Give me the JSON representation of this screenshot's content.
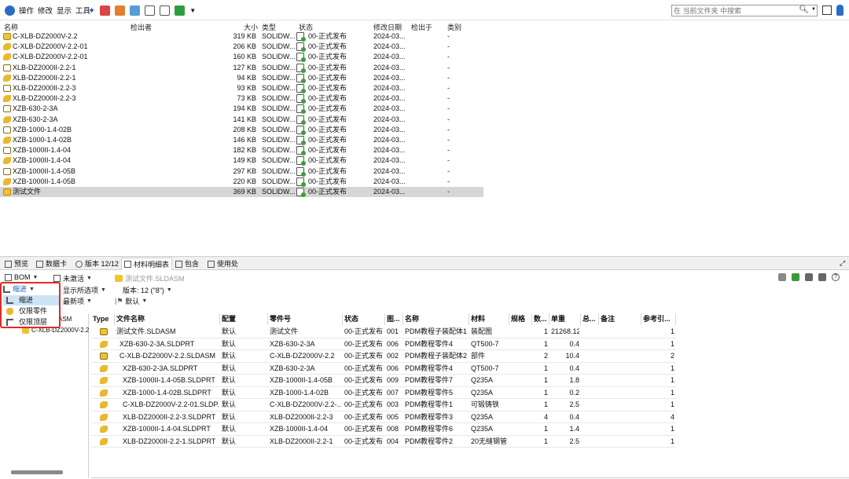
{
  "toolbar": {
    "actions": [
      "操作",
      "修改",
      "显示",
      "工具"
    ],
    "search_placeholder": "在 当前文件夹 中搜索"
  },
  "filelist": {
    "columns": {
      "name": "名称",
      "checked_out_by": "检出者",
      "size": "大小",
      "type": "类型",
      "state": "状态",
      "modified": "修改日期",
      "checked_out_in": "检出于",
      "category": "类别"
    },
    "rows": [
      {
        "name": "C-XLB-DZ2000V-2.2",
        "size": "319 KB",
        "type": "SOLIDW...",
        "state": "00-正式发布",
        "date": "2024-03...",
        "cat": "-",
        "kind": "asm"
      },
      {
        "name": "C-XLB-DZ2000V-2.2-01",
        "size": "206 KB",
        "type": "SOLIDW...",
        "state": "00-正式发布",
        "date": "2024-03...",
        "cat": "-",
        "kind": "prt"
      },
      {
        "name": "C-XLB-DZ2000V-2.2-01",
        "size": "160 KB",
        "type": "SOLIDW...",
        "state": "00-正式发布",
        "date": "2024-03...",
        "cat": "-",
        "kind": "prt"
      },
      {
        "name": "XLB-DZ2000II-2.2-1",
        "size": "127 KB",
        "type": "SOLIDW...",
        "state": "00-正式发布",
        "date": "2024-03...",
        "cat": "-",
        "kind": "drw"
      },
      {
        "name": "XLB-DZ2000II-2.2-1",
        "size": "94 KB",
        "type": "SOLIDW...",
        "state": "00-正式发布",
        "date": "2024-03...",
        "cat": "-",
        "kind": "prt"
      },
      {
        "name": "XLB-DZ2000II-2.2-3",
        "size": "93 KB",
        "type": "SOLIDW...",
        "state": "00-正式发布",
        "date": "2024-03...",
        "cat": "-",
        "kind": "drw"
      },
      {
        "name": "XLB-DZ2000II-2.2-3",
        "size": "73 KB",
        "type": "SOLIDW...",
        "state": "00-正式发布",
        "date": "2024-03...",
        "cat": "-",
        "kind": "prt"
      },
      {
        "name": "XZB-630-2-3A",
        "size": "194 KB",
        "type": "SOLIDW...",
        "state": "00-正式发布",
        "date": "2024-03...",
        "cat": "-",
        "kind": "drw"
      },
      {
        "name": "XZB-630-2-3A",
        "size": "141 KB",
        "type": "SOLIDW...",
        "state": "00-正式发布",
        "date": "2024-03...",
        "cat": "-",
        "kind": "prt"
      },
      {
        "name": "XZB-1000-1.4-02B",
        "size": "208 KB",
        "type": "SOLIDW...",
        "state": "00-正式发布",
        "date": "2024-03...",
        "cat": "-",
        "kind": "drw"
      },
      {
        "name": "XZB-1000-1.4-02B",
        "size": "146 KB",
        "type": "SOLIDW...",
        "state": "00-正式发布",
        "date": "2024-03...",
        "cat": "-",
        "kind": "prt"
      },
      {
        "name": "XZB-1000II-1.4-04",
        "size": "182 KB",
        "type": "SOLIDW...",
        "state": "00-正式发布",
        "date": "2024-03...",
        "cat": "-",
        "kind": "drw"
      },
      {
        "name": "XZB-1000II-1.4-04",
        "size": "149 KB",
        "type": "SOLIDW...",
        "state": "00-正式发布",
        "date": "2024-03...",
        "cat": "-",
        "kind": "prt"
      },
      {
        "name": "XZB-1000II-1.4-05B",
        "size": "297 KB",
        "type": "SOLIDW...",
        "state": "00-正式发布",
        "date": "2024-03...",
        "cat": "-",
        "kind": "drw"
      },
      {
        "name": "XZB-1000II-1.4-05B",
        "size": "220 KB",
        "type": "SOLIDW...",
        "state": "00-正式发布",
        "date": "2024-03...",
        "cat": "-",
        "kind": "prt"
      },
      {
        "name": "测试文件",
        "size": "369 KB",
        "type": "SOLIDW...",
        "state": "00-正式发布",
        "date": "2024-03...",
        "cat": "-",
        "kind": "asm"
      }
    ]
  },
  "bottom_tabs": {
    "preview": "预览",
    "datacard": "数据卡",
    "version": "版本 12/12",
    "bom": "材料明细表",
    "contains": "包含",
    "where_used": "使用处"
  },
  "bom_toolbar": {
    "bom": "BOM",
    "inactive": "未激活",
    "filename": "测试文件.SLDASM",
    "show_selected": "显示所选项",
    "version": "版本: 12 (\"8\")",
    "latest": "最新项",
    "default": "默认"
  },
  "dropdown": {
    "current": "缩进",
    "items": [
      "缩进",
      "仅限零件",
      "仅限顶层"
    ]
  },
  "tree": {
    "item1": "ASM",
    "item2": "C-XLB-DZ2000V-2.2"
  },
  "bom_table": {
    "columns": [
      "Type",
      "文件名称",
      "配置",
      "零件号",
      "状态",
      "图...",
      "名称",
      "材料",
      "规格",
      "数...",
      "单重",
      "总...",
      "备注",
      "参考引..."
    ],
    "rows": [
      {
        "file": "测试文件.SLDASM",
        "cfg": "默认",
        "pn": "测试文件",
        "state": "00-正式发布",
        "fig": "001",
        "name": "PDM教程子装配体1",
        "mat": "装配图",
        "qty": "1",
        "wt": "21268.12",
        "ref": "1",
        "kind": "asm",
        "indent": 0
      },
      {
        "file": "XZB-630-2-3A.SLDPRT",
        "cfg": "默认",
        "pn": "XZB-630-2-3A",
        "state": "00-正式发布",
        "fig": "006",
        "name": "PDM教程零件4",
        "mat": "QT500-7",
        "qty": "1",
        "wt": "0.4",
        "ref": "1",
        "kind": "prt",
        "indent": 1
      },
      {
        "file": "C-XLB-DZ2000V-2.2.SLDASM",
        "cfg": "默认",
        "pn": "C-XLB-DZ2000V-2.2",
        "state": "00-正式发布",
        "fig": "002",
        "name": "PDM教程子装配体2",
        "mat": "部件",
        "qty": "2",
        "wt": "10.4",
        "ref": "2",
        "kind": "asm",
        "indent": 1
      },
      {
        "file": "XZB-630-2-3A.SLDPRT",
        "cfg": "默认",
        "pn": "XZB-630-2-3A",
        "state": "00-正式发布",
        "fig": "006",
        "name": "PDM教程零件4",
        "mat": "QT500-7",
        "qty": "1",
        "wt": "0.4",
        "ref": "1",
        "kind": "prt",
        "indent": 2
      },
      {
        "file": "XZB-1000II-1.4-05B.SLDPRT",
        "cfg": "默认",
        "pn": "XZB-1000II-1.4-05B",
        "state": "00-正式发布",
        "fig": "009",
        "name": "PDM教程零件7",
        "mat": "Q235A",
        "qty": "1",
        "wt": "1.8",
        "ref": "1",
        "kind": "prt",
        "indent": 2
      },
      {
        "file": "XZB-1000-1.4-02B.SLDPRT",
        "cfg": "默认",
        "pn": "XZB-1000-1.4-02B",
        "state": "00-正式发布",
        "fig": "007",
        "name": "PDM教程零件5",
        "mat": "Q235A",
        "qty": "1",
        "wt": "0.2",
        "ref": "1",
        "kind": "prt",
        "indent": 2
      },
      {
        "file": "C-XLB-DZ2000V-2.2-01.SLDP...",
        "cfg": "默认",
        "pn": "C-XLB-DZ2000V-2.2-...",
        "state": "00-正式发布",
        "fig": "003",
        "name": "PDM教程零件1",
        "mat": "可锻铸铁",
        "qty": "1",
        "wt": "2.5",
        "ref": "1",
        "kind": "prt",
        "indent": 2
      },
      {
        "file": "XLB-DZ2000II-2.2-3.SLDPRT",
        "cfg": "默认",
        "pn": "XLB-DZ2000II-2.2-3",
        "state": "00-正式发布",
        "fig": "005",
        "name": "PDM教程零件3",
        "mat": "Q235A",
        "qty": "4",
        "wt": "0.4",
        "ref": "4",
        "kind": "prt",
        "indent": 2
      },
      {
        "file": "XZB-1000II-1.4-04.SLDPRT",
        "cfg": "默认",
        "pn": "XZB-1000II-1.4-04",
        "state": "00-正式发布",
        "fig": "008",
        "name": "PDM教程零件6",
        "mat": "Q235A",
        "qty": "1",
        "wt": "1.4",
        "ref": "1",
        "kind": "prt",
        "indent": 2
      },
      {
        "file": "XLB-DZ2000II-2.2-1.SLDPRT",
        "cfg": "默认",
        "pn": "XLB-DZ2000II-2.2-1",
        "state": "00-正式发布",
        "fig": "004",
        "name": "PDM教程零件2",
        "mat": "20无缝钢管",
        "qty": "1",
        "wt": "2.5",
        "ref": "1",
        "kind": "prt",
        "indent": 2
      }
    ]
  },
  "colors": {
    "selected_row": "#d6d6d6",
    "dropdown_border": "#e02a2a",
    "dropdown_highlight": "#cce4f7",
    "icon_yellow": "#f2c230"
  }
}
